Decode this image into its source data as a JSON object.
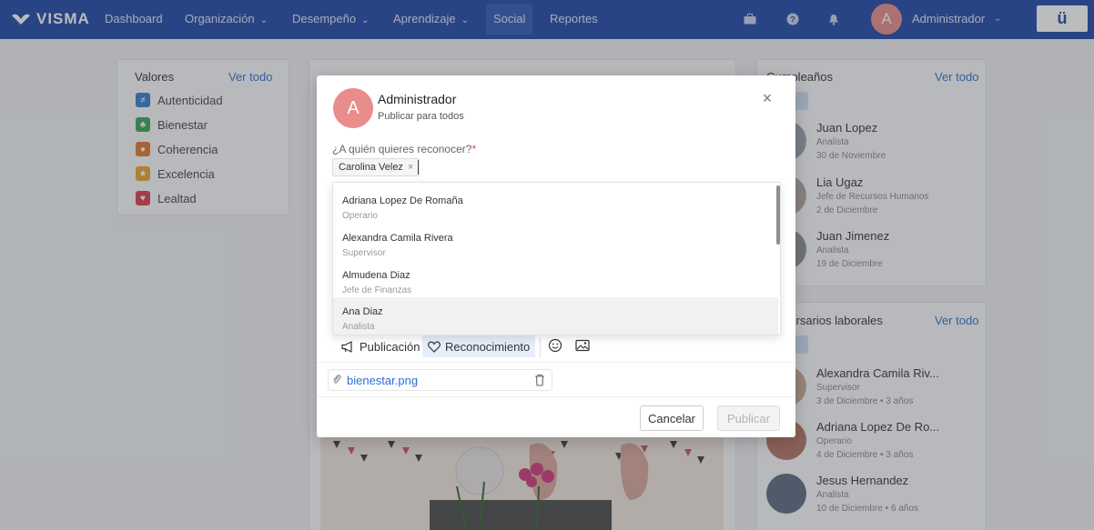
{
  "nav": {
    "logo": "VISMA",
    "items": [
      {
        "label": "Dashboard",
        "chevron": ""
      },
      {
        "label": "Organización",
        "chevron": "⌄"
      },
      {
        "label": "Desempeño",
        "chevron": "⌄"
      },
      {
        "label": "Aprendizaje",
        "chevron": "⌄"
      },
      {
        "label": "Social",
        "chevron": ""
      },
      {
        "label": "Reportes",
        "chevron": ""
      }
    ],
    "active": "Social",
    "avatar_letter": "A",
    "user": "Administrador",
    "user_chevron": "⌄",
    "brand_button": "ü",
    "icons": [
      "briefcase-icon",
      "help-icon",
      "bell-icon"
    ]
  },
  "values_card": {
    "title": "Valores",
    "link": "Ver todo",
    "items": [
      {
        "label": "Autenticidad",
        "icon": "≠",
        "color": "#2e7fd1"
      },
      {
        "label": "Bienestar",
        "icon": "♣",
        "color": "#3aa55a"
      },
      {
        "label": "Coherencia",
        "icon": "●",
        "color": "#e0782a"
      },
      {
        "label": "Excelencia",
        "icon": "★",
        "color": "#e8a52b"
      },
      {
        "label": "Lealtad",
        "icon": "♥",
        "color": "#dc3d4a"
      }
    ]
  },
  "birthdays_card": {
    "title": "Cumpleaños",
    "link": "Ver todo",
    "people": [
      {
        "name": "Juan Lopez",
        "role": "Analista",
        "date": "30 de Noviembre"
      },
      {
        "name": "Lia Ugaz",
        "role": "Jefe de Recursos Humanos",
        "date": "2 de Diciembre"
      },
      {
        "name": "Juan Jimenez",
        "role": "Analista",
        "date": "19 de Diciembre"
      }
    ]
  },
  "anniversaries_card": {
    "title": "Aniversarios laborales",
    "link": "Ver todo",
    "people": [
      {
        "name": "Alexandra Camila Riv...",
        "role": "Supervisor",
        "date": "3 de Diciembre • 3 años"
      },
      {
        "name": "Adriana Lopez De Ro...",
        "role": "Operario",
        "date": "4 de Diciembre • 3 años"
      },
      {
        "name": "Jesus Hernandez",
        "role": "Analista",
        "date": "10 de Diciembre • 6 años"
      }
    ]
  },
  "modal": {
    "avatar_letter": "A",
    "author": "Administrador",
    "audience": "Publicar para todos",
    "close": "×",
    "question": "¿A quién quieres reconocer?",
    "required_mark": "*",
    "selected_chip": "Carolina Velez",
    "chip_remove": "×",
    "dropdown": [
      {
        "name": "Adriana Lopez De Romaña",
        "role": "Operario"
      },
      {
        "name": "Alexandra Camila Rivera",
        "role": "Supervisor"
      },
      {
        "name": "Almudena Diaz",
        "role": "Jefe de Finanzas"
      },
      {
        "name": "Ana Diaz",
        "role": "Analista"
      }
    ],
    "toolbar": {
      "publicacion": "Publicación",
      "reconocimiento": "Reconocimiento"
    },
    "attachment": "bienestar.png",
    "cancel": "Cancelar",
    "publish": "Publicar"
  }
}
